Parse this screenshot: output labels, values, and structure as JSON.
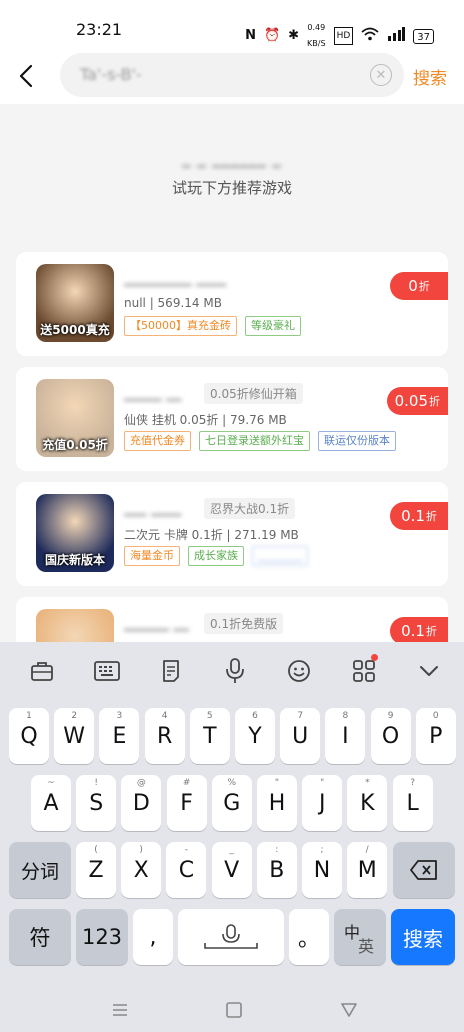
{
  "status_bar": {
    "time": "23:21",
    "network_speed_value": "0.49",
    "network_speed_unit": "KB/S",
    "battery": "37"
  },
  "search": {
    "value": "Ta'-s-B'-",
    "clear_icon": "clear-circle-icon",
    "submit_label": "搜索"
  },
  "empty_state": {
    "title": "_ _ ______ _",
    "hint": "试玩下方推荐游戏"
  },
  "games": [
    {
      "name": "_________ ____",
      "sub_badge": "",
      "meta": "null | 569.14 MB",
      "tags": [
        {
          "text": "【50000】真充金砖",
          "color": "orange"
        },
        {
          "text": "等级豪礼",
          "color": "green"
        }
      ],
      "discount_value": "0",
      "discount_unit": "折",
      "cover_text": "送5000真充",
      "cover_color": "#6b4a2f"
    },
    {
      "name": "_____ __",
      "sub_badge": "0.05折修仙开箱",
      "meta": "仙侠 挂机 0.05折 | 79.76 MB",
      "tags": [
        {
          "text": "充值代金券",
          "color": "orange"
        },
        {
          "text": "七日登录送额外红宝",
          "color": "green"
        },
        {
          "text": "联运仅份版本",
          "color": "blue"
        }
      ],
      "discount_value": "0.05",
      "discount_unit": "折",
      "cover_text": "充值0.05折",
      "cover_color": "#c9b39a"
    },
    {
      "name": "___ ____",
      "sub_badge": "忍界大战0.1折",
      "meta": "二次元 卡牌 0.1折 | 271.19 MB",
      "tags": [
        {
          "text": "海量金币",
          "color": "orange"
        },
        {
          "text": "成长家族",
          "color": "green"
        },
        {
          "text": "________",
          "color": "blur"
        }
      ],
      "discount_value": "0.1",
      "discount_unit": "折",
      "cover_text": "国庆新版本",
      "cover_color": "#1d2a5a"
    },
    {
      "name": "______ __",
      "sub_badge": "0.1折免费版",
      "meta": "",
      "tags": [],
      "discount_value": "0.1",
      "discount_unit": "折",
      "cover_text": "",
      "cover_color": "#e9b27a"
    }
  ],
  "keyboard": {
    "toolbar": [
      "toolbox-icon",
      "keyboard-layout-icon",
      "clipboard-icon",
      "voice-icon",
      "emoji-icon",
      "apps-icon",
      "collapse-icon"
    ],
    "row1": [
      {
        "main": "Q",
        "hint": "1"
      },
      {
        "main": "W",
        "hint": "2"
      },
      {
        "main": "E",
        "hint": "3"
      },
      {
        "main": "R",
        "hint": "4"
      },
      {
        "main": "T",
        "hint": "5"
      },
      {
        "main": "Y",
        "hint": "6"
      },
      {
        "main": "U",
        "hint": "7"
      },
      {
        "main": "I",
        "hint": "8"
      },
      {
        "main": "O",
        "hint": "9"
      },
      {
        "main": "P",
        "hint": "0"
      }
    ],
    "row2": [
      {
        "main": "A",
        "hint": "~"
      },
      {
        "main": "S",
        "hint": "!"
      },
      {
        "main": "D",
        "hint": "@"
      },
      {
        "main": "F",
        "hint": "#"
      },
      {
        "main": "G",
        "hint": "%"
      },
      {
        "main": "H",
        "hint": "\""
      },
      {
        "main": "J",
        "hint": "\""
      },
      {
        "main": "K",
        "hint": "*"
      },
      {
        "main": "L",
        "hint": "?"
      }
    ],
    "row3": [
      {
        "main": "Z",
        "hint": "("
      },
      {
        "main": "X",
        "hint": ")"
      },
      {
        "main": "C",
        "hint": "-"
      },
      {
        "main": "V",
        "hint": "_"
      },
      {
        "main": "B",
        "hint": ":"
      },
      {
        "main": "N",
        "hint": ";"
      },
      {
        "main": "M",
        "hint": "/"
      }
    ],
    "segment_label": "分词",
    "symbol_label": "符",
    "num_label": "123",
    "comma_label": ",",
    "period_label": "。",
    "lang_label_top": "中",
    "lang_label_bottom": "英",
    "search_label": "搜索"
  }
}
